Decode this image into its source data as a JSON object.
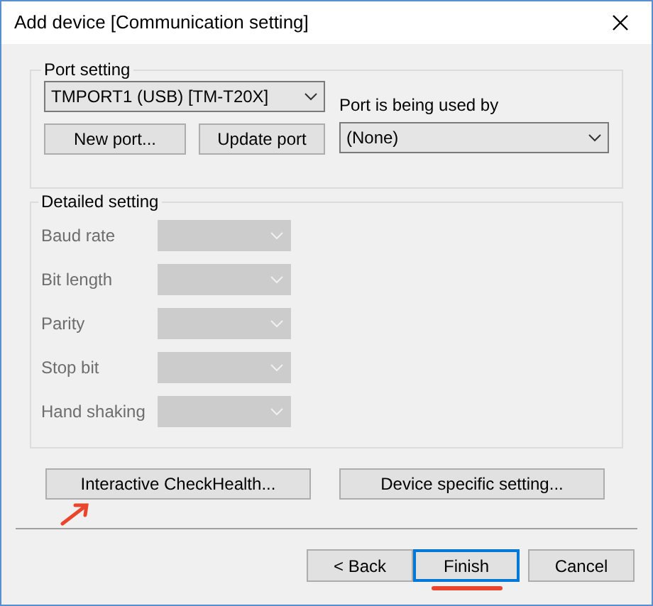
{
  "window": {
    "title": "Add device [Communication setting]"
  },
  "port_setting": {
    "title": "Port setting",
    "port": {
      "value": "TMPORT1 (USB) [TM-T20X]"
    },
    "buttons": [
      "New port...",
      "Update port"
    ],
    "used_by": {
      "label": "Port is being used by",
      "value": "(None)"
    }
  },
  "detailed_setting": {
    "title": "Detailed setting",
    "fields": [
      {
        "label": "Baud rate",
        "disabled": true
      },
      {
        "label": "Bit length",
        "disabled": true
      },
      {
        "label": "Parity",
        "disabled": true
      },
      {
        "label": "Stop bit",
        "disabled": true
      },
      {
        "label": "Hand shaking",
        "disabled": true
      }
    ]
  },
  "action_buttons": [
    "Interactive CheckHealth...",
    "Device specific setting..."
  ],
  "footer_buttons": [
    {
      "label": "< Back",
      "default": false
    },
    {
      "label": "Finish",
      "default": true
    },
    {
      "label": "Cancel",
      "default": false
    }
  ]
}
